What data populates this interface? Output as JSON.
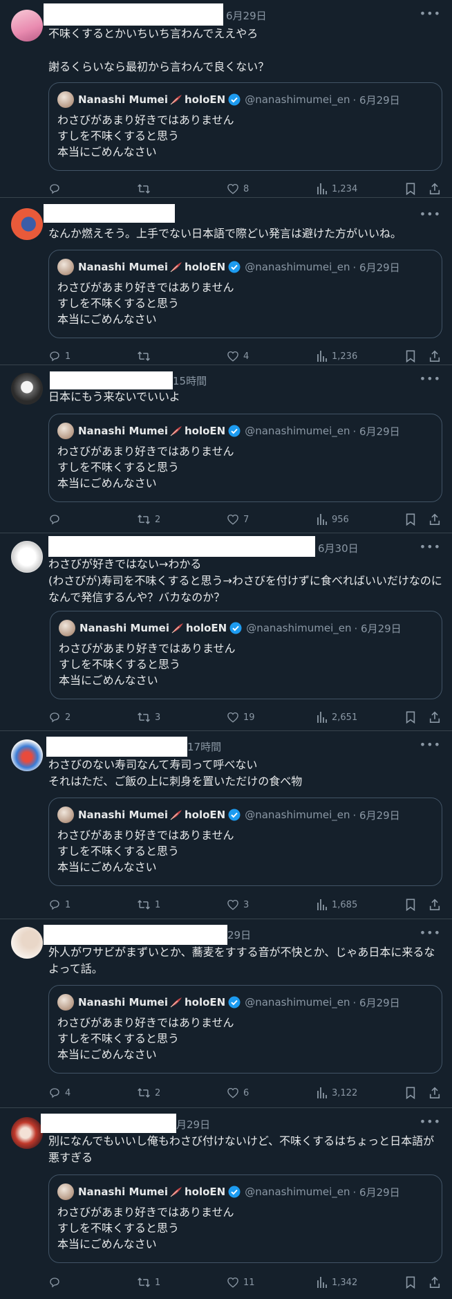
{
  "quote": {
    "name": "Nanashi Mumei",
    "name_suffix": "holoEN",
    "handle": "@nanashimumei_en",
    "time": "· 6月29日",
    "text": "わさびがあまり好きではありません\nすしを不味くすると思う\n本当にごめんなさい"
  },
  "tweets": [
    {
      "time": "6月29日",
      "text": "不味くするとかいちいち言わんでええやろ\n\n謝るくらいなら最初から言わんで良くない？",
      "replies": "",
      "retweets": "",
      "likes": "8",
      "views": "1,234"
    },
    {
      "time": "",
      "text": "なんか燃えそう。上手でない日本語で際どい発言は避けた方がいいね。",
      "replies": "1",
      "retweets": "",
      "likes": "4",
      "views": "1,236"
    },
    {
      "time": "15時間",
      "text": "日本にもう来ないでいいよ",
      "replies": "",
      "retweets": "2",
      "likes": "7",
      "views": "956"
    },
    {
      "time": "6月30日",
      "text": "わさびが好きではない→わかる\n(わさびが)寿司を不味くすると思う→わさびを付けずに食べればいいだけなのになんで発信するんや？バカなのか？",
      "replies": "2",
      "retweets": "3",
      "likes": "19",
      "views": "2,651"
    },
    {
      "time": "17時間",
      "text": "わさびのない寿司なんて寿司って呼べない\nそれはただ、ご飯の上に刺身を置いただけの食べ物",
      "replies": "1",
      "retweets": "1",
      "likes": "3",
      "views": "1,685"
    },
    {
      "time": "29日",
      "text": "外人がワサビがまずいとか、蕎麦をすする音が不快とか、じゃあ日本に来るなよって話。",
      "replies": "4",
      "retweets": "2",
      "likes": "6",
      "views": "3,122"
    },
    {
      "time": "月29日",
      "text": "別になんでもいいし俺もわさび付けないけど、不味くするはちょっと日本語が悪すぎる",
      "replies": "",
      "retweets": "1",
      "likes": "11",
      "views": "1,342"
    }
  ],
  "icons": {
    "reply": "reply-icon",
    "retweet": "retweet-icon",
    "like": "heart-icon",
    "views": "views-icon",
    "bookmark": "bookmark-icon",
    "share": "share-icon",
    "more": "more-icon",
    "verified": "verified-badge-icon",
    "feather": "feather-icon"
  },
  "colors": {
    "background": "#15202b",
    "text": "#e7e9ea",
    "muted": "#8b98a5",
    "verified": "#1d9bf0"
  }
}
